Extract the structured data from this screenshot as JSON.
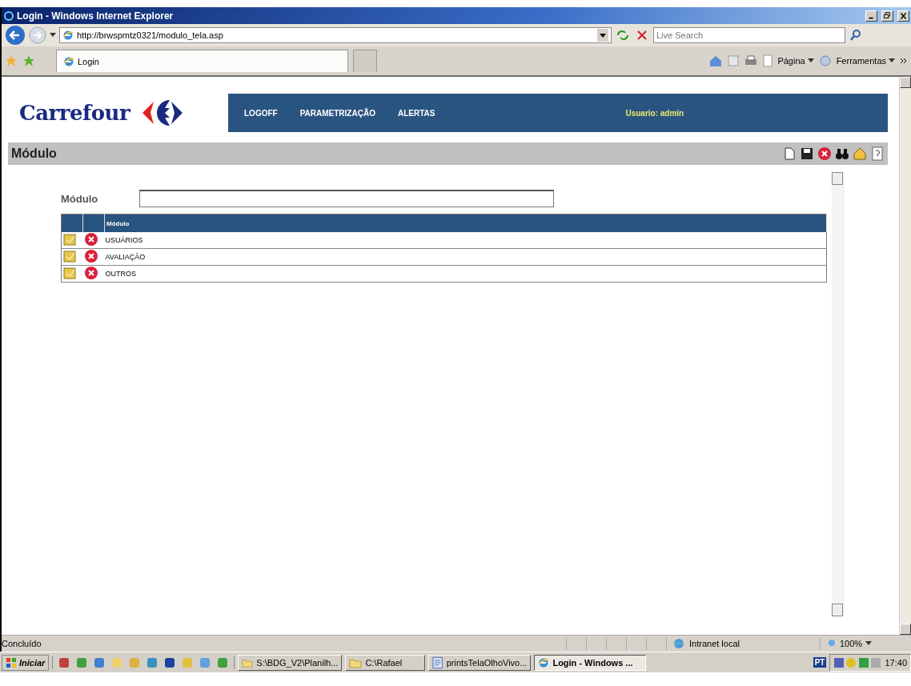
{
  "window": {
    "title": "Login - Windows Internet Explorer"
  },
  "address_bar": {
    "url": "http://brwspmtz0321/modulo_tela.asp",
    "search_placeholder": "Live Search"
  },
  "tabs": [
    {
      "label": "Login",
      "selected": true
    }
  ],
  "command_bar": [
    "Página",
    "Ferramentas"
  ],
  "page": {
    "brand": "Carrefour",
    "nav": [
      "LOGOFF",
      "PARAMETRIZAÇÃO",
      "ALERTAS"
    ],
    "user": "Usuario: admin",
    "section_title": "Módulo",
    "form": {
      "label": "Módulo"
    },
    "table": {
      "columns": [
        "Módulo"
      ],
      "rows": [
        {
          "cells": [
            "USUÁRIOS"
          ]
        },
        {
          "cells": [
            "AVALIAÇÃO"
          ]
        },
        {
          "cells": [
            "OUTROS"
          ]
        }
      ]
    }
  },
  "status_bar": {
    "text": "Concluído",
    "zone": "Intranet local",
    "zoom": "100%"
  },
  "taskbar": {
    "start": "Iniciar",
    "tasks": [
      {
        "label": "S:\\BDG_V2\\Planilh...",
        "kind": "folder",
        "selected": false
      },
      {
        "label": "C:\\Rafael",
        "kind": "folder",
        "selected": false
      },
      {
        "label": "printsTelaOlhoVivo...",
        "kind": "document",
        "selected": false
      },
      {
        "label": "Login - Windows ...",
        "kind": "browser",
        "selected": true
      }
    ],
    "language": "PT",
    "clock": "17:40"
  }
}
